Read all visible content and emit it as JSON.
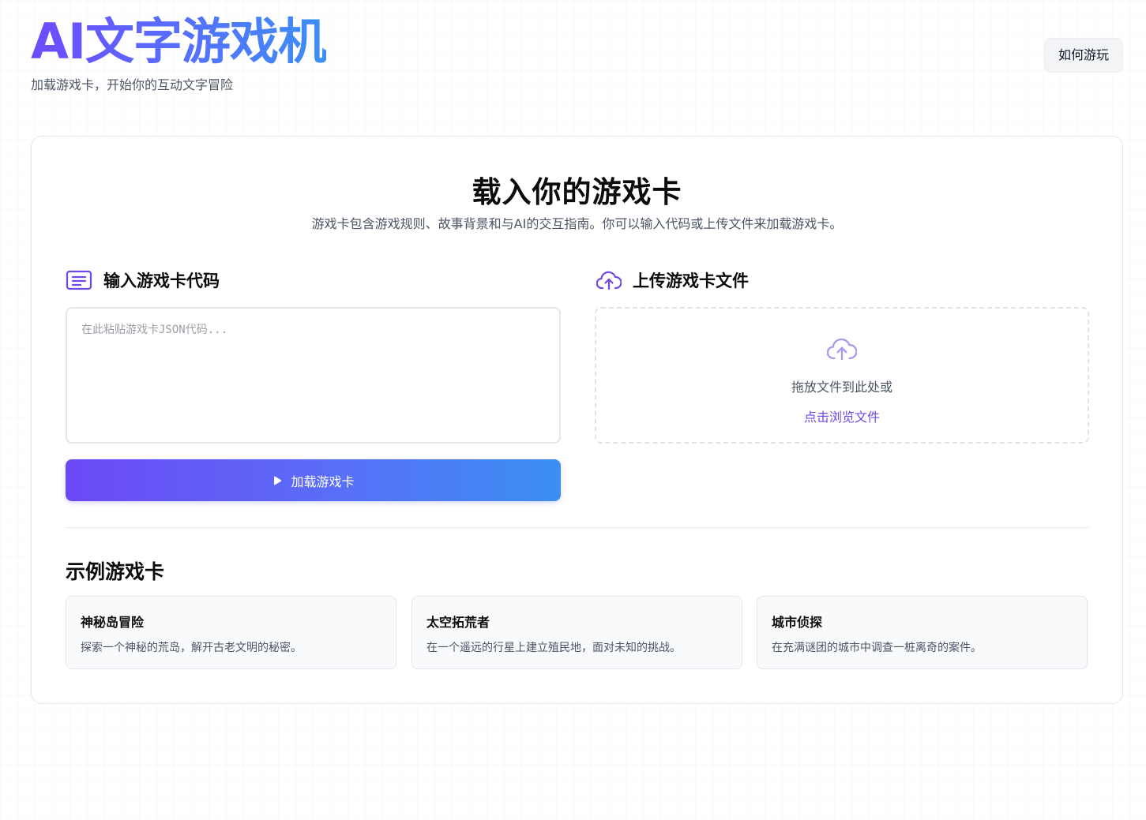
{
  "header": {
    "title": "AI文字游戏机",
    "subtitle": "加载游戏卡，开始你的互动文字冒险",
    "help_label": "如何游玩"
  },
  "main": {
    "title": "载入你的游戏卡",
    "description": "游戏卡包含游戏规则、故事背景和与AI的交互指南。你可以输入代码或上传文件来加载游戏卡。",
    "code_section": {
      "label": "输入游戏卡代码",
      "icon": "document-lines-icon",
      "placeholder": "在此粘贴游戏卡JSON代码...",
      "value": "",
      "load_button_label": "加载游戏卡",
      "load_button_icon": "play-icon"
    },
    "upload_section": {
      "label": "上传游戏卡文件",
      "icon": "cloud-upload-icon",
      "drop_text": "拖放文件到此处或",
      "browse_link": "点击浏览文件"
    }
  },
  "examples": {
    "title": "示例游戏卡",
    "cards": [
      {
        "title": "神秘岛冒险",
        "description": "探索一个神秘的荒岛，解开古老文明的秘密。"
      },
      {
        "title": "太空拓荒者",
        "description": "在一个遥远的行星上建立殖民地，面对未知的挑战。"
      },
      {
        "title": "城市侦探",
        "description": "在充满谜团的城市中调查一桩离奇的案件。"
      }
    ]
  },
  "colors": {
    "accent_purple": "#6c48f5",
    "accent_blue": "#3b8ff3",
    "link": "#7048e8"
  }
}
